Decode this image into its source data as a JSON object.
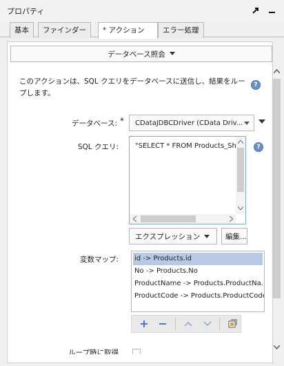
{
  "window": {
    "title": "プロパティ",
    "pin_icon": "pin-arrow-icon",
    "minimize_icon": "minimize-icon"
  },
  "tabs": [
    {
      "label": "基本",
      "active": false
    },
    {
      "label": "ファインダー",
      "active": false
    },
    {
      "label": "* アクション",
      "active": true
    },
    {
      "label": "エラー処理",
      "active": false
    }
  ],
  "action_selector": {
    "label": "データベース照会",
    "icon": "dropdown-arrow-icon"
  },
  "description": "このアクションは、SQL クエリをデータベースに送信し、結果をループします。",
  "database": {
    "label": "データベース:",
    "required_mark": "*",
    "value": "CDataJDBCDriver (CData Driv..."
  },
  "sql_query": {
    "label": "SQL クエリ:",
    "value": "\"SELECT * FROM Products_Sh"
  },
  "expression_button": "エクスプレッション",
  "edit_button": "編集...",
  "variable_map": {
    "label": "変数マップ:",
    "items": [
      "id -> Products.id",
      "No -> Products.No",
      "ProductName -> Products.ProductNa...",
      "ProductCode -> Products.ProductCode"
    ],
    "selected_index": 0
  },
  "map_toolbar": [
    "add-icon",
    "remove-icon",
    "move-up-icon",
    "move-down-icon",
    "edit-mapping-icon"
  ],
  "loop_label": "ループ時に取得",
  "colors": {
    "panel_bg": "#ffffff",
    "selection": "#b7c9e6",
    "help_icon": "#6a8fc6",
    "focus_border": "#7ea7d8"
  }
}
